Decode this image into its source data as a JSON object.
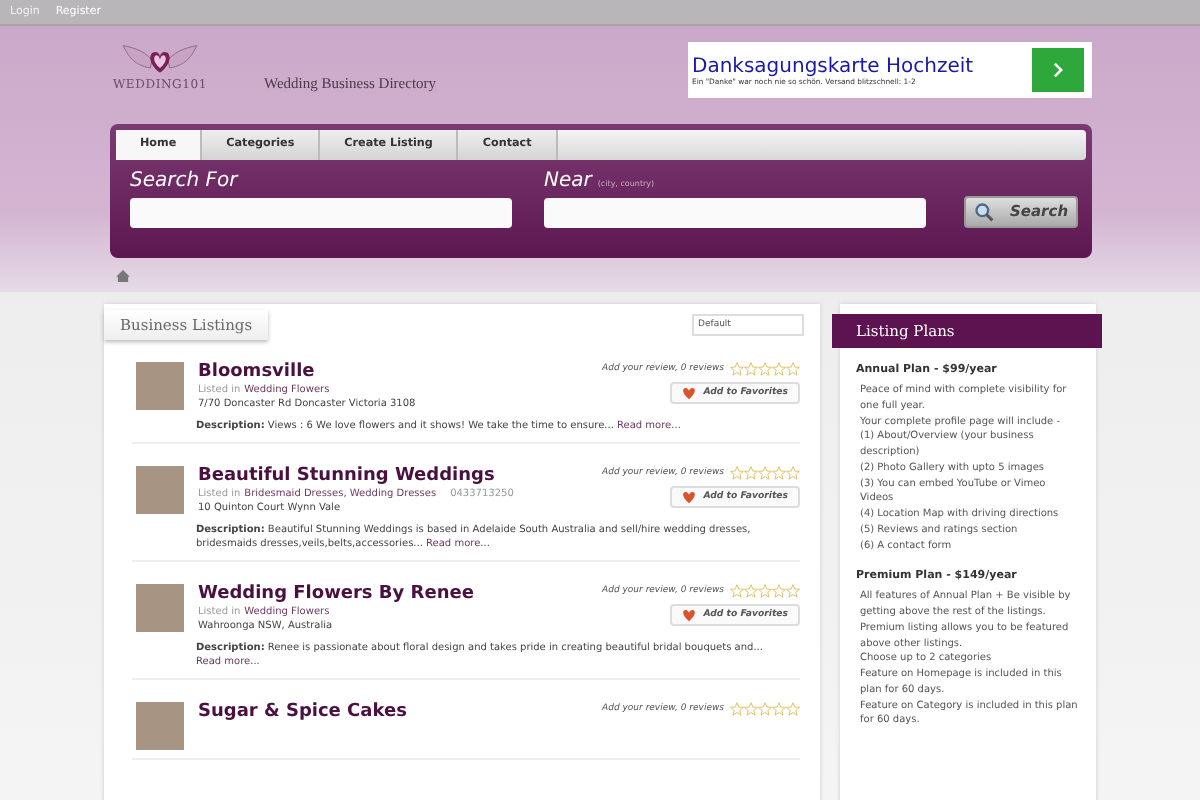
{
  "top_bar": {
    "links": [
      "Login",
      "Register"
    ]
  },
  "header": {
    "logo_text": "WEDDING101",
    "tagline": "Wedding Business Directory",
    "ad": {
      "title": "Danksagungskarte Hochzeit",
      "text": "Ein \"Danke\" war noch nie so schön. Versand blitzschnell: 1-2"
    }
  },
  "nav": {
    "tabs": [
      {
        "label": "Home",
        "selected": true
      },
      {
        "label": "Categories",
        "selected": false
      },
      {
        "label": "Create Listing",
        "selected": false
      },
      {
        "label": "Contact",
        "selected": false
      }
    ]
  },
  "search": {
    "search_for_label": "Search For",
    "near_label": "Near",
    "near_hint": "(city, country)",
    "button": "Search"
  },
  "listings_panel": {
    "title": "Business Listings",
    "sort": "Default",
    "listings": [
      {
        "name": "Bloomsville",
        "listed_in_label": "Listed in",
        "categories": "Wedding Flowers",
        "address": "7/70 Doncaster Rd Doncaster Victoria 3108",
        "description": "**Description:** Views : 6 We love flowers and it shows! We take the time to ensure...",
        "read_more": "Read more...",
        "review_link": "Add your review, 0 reviews",
        "stars": 0,
        "favorite_button": "Add to Favorites"
      },
      {
        "name": "Beautiful Stunning Weddings",
        "listed_in_label": "Listed in",
        "categories": "Bridesmaid Dresses, Wedding Dresses",
        "phone": "0433713250",
        "address": "10 Quinton Court Wynn Vale",
        "description": "**Description:** Beautiful Stunning Weddings is based in Adelaide South Australia and sell/hire wedding dresses, bridesmaids dresses,veils,belts,accessories...",
        "read_more": "Read more...",
        "review_link": "Add your review, 0 reviews",
        "stars": 0,
        "favorite_button": "Add to Favorites"
      },
      {
        "name": "Wedding Flowers By Renee",
        "listed_in_label": "Listed in",
        "categories": "Wedding Flowers",
        "address": "Wahroonga NSW, Australia",
        "description": "**Description:** Renee is passionate about floral design and takes pride in creating beautiful bridal bouquets and...",
        "read_more": "Read more...",
        "review_link": "Add your review, 0 reviews",
        "stars": 0,
        "favorite_button": "Add to Favorites"
      },
      {
        "name": "Sugar & Spice Cakes",
        "review_link": "Add your review, 0 reviews",
        "stars": 0
      }
    ]
  },
  "sidebar": {
    "title": "Listing Plans",
    "plans": [
      {
        "name": "Annual Plan - $99/year",
        "lines": [
          "Peace of mind with complete visibility for one full year.",
          "Your complete profile page will include -",
          "(1) About/Overview (your business description)",
          "(2) Photo Gallery with upto 5 images",
          "(3) You can embed YouTube or Vimeo Videos",
          "(4) Location Map with driving directions",
          "(5) Reviews and ratings section",
          "(6) A contact form"
        ]
      },
      {
        "name": "Premium Plan - $149/year",
        "lines": [
          "All features of Annual Plan + Be visible by getting above the rest of the listings. Premium listing allows you to be featured above other listings.",
          "Choose up to 2 categories",
          "Feature on Homepage is included in this plan for 60 days.",
          "Feature on Category is included in this plan for 60 days."
        ]
      }
    ]
  }
}
